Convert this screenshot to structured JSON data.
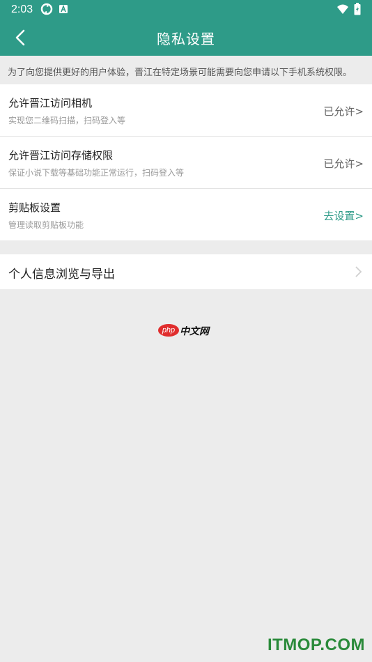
{
  "status_bar": {
    "time": "2:03",
    "left_icons": [
      "sync-icon",
      "a-badge-icon"
    ],
    "right_icons": [
      "wifi-icon",
      "battery-icon"
    ]
  },
  "header": {
    "title": "隐私设置",
    "back_icon": "chevron-left-icon",
    "color": "#2e9b88"
  },
  "notice": "为了向您提供更好的用户体验，晋江在特定场景可能需要向您申请以下手机系统权限。",
  "permissions": [
    {
      "title": "允许晋江访问相机",
      "desc": "实现您二维码扫描，扫码登入等",
      "status": "已允许>"
    },
    {
      "title": "允许晋江访问存储权限",
      "desc": "保证小说下载等基础功能正常运行，扫码登入等",
      "status": "已允许>"
    },
    {
      "title": "剪贴板设置",
      "desc": "管理读取剪贴板功能",
      "status": "去设置>"
    }
  ],
  "info_export": {
    "label": "个人信息浏览与导出",
    "icon": "chevron-right-icon"
  },
  "logo": {
    "badge": "php",
    "text": "中文网"
  },
  "watermark": "ITMOP.COM"
}
